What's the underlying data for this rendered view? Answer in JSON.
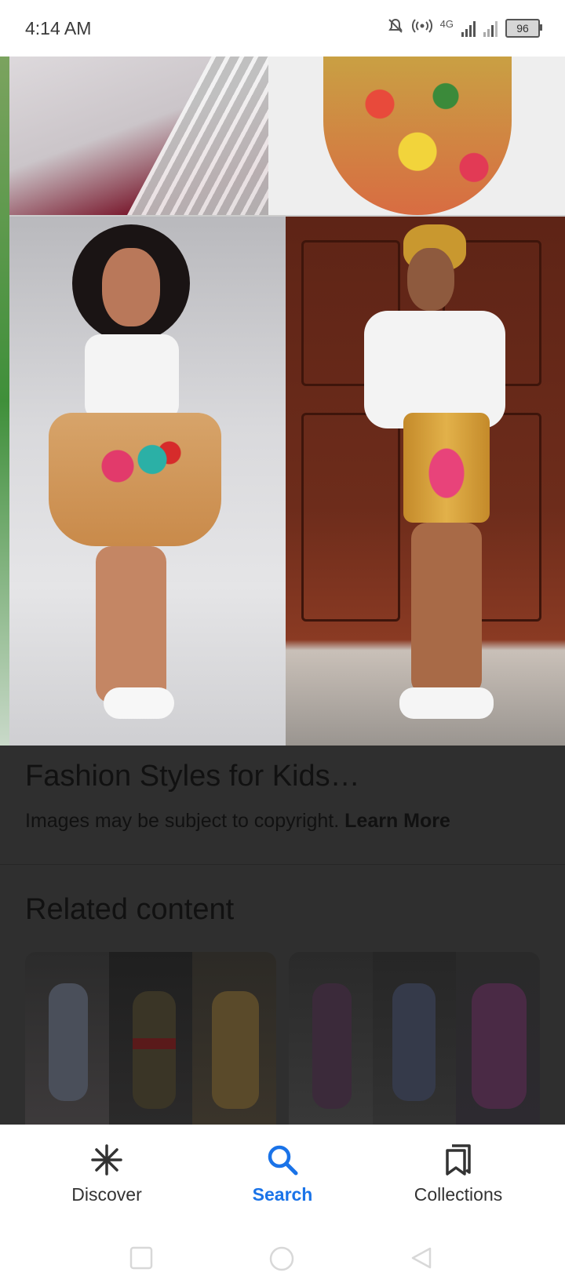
{
  "status_bar": {
    "time": "4:14 AM",
    "network": "4G",
    "battery": "96",
    "icons": [
      "mute-bell-icon",
      "hotspot-icon",
      "signal-icon",
      "signal-icon",
      "battery-icon"
    ]
  },
  "result": {
    "title": "Fashion Styles for Kids…",
    "copyright_text": "Images may be subject to copyright.",
    "learn_more": "Learn More"
  },
  "related": {
    "heading": "Related content"
  },
  "bottom_nav": {
    "items": [
      {
        "label": "Discover",
        "icon": "asterisk-icon",
        "active": false
      },
      {
        "label": "Search",
        "icon": "search-icon",
        "active": true
      },
      {
        "label": "Collections",
        "icon": "bookmarks-icon",
        "active": false
      }
    ]
  },
  "colors": {
    "accent": "#1a73e8",
    "scrim": "#2f2f2f"
  }
}
